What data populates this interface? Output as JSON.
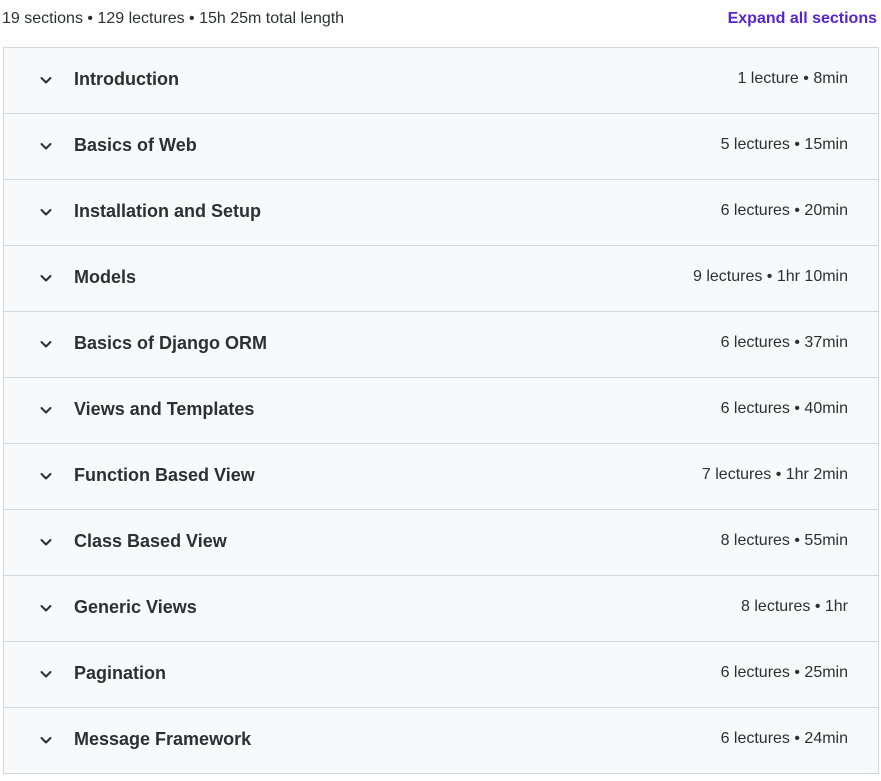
{
  "header": {
    "summary": "19 sections • 129 lectures • 15h 25m total length",
    "expand_all_label": "Expand all sections"
  },
  "colors": {
    "link": "#5624d0",
    "row_background": "#f7f9fa",
    "border": "#d1d7dc",
    "text": "#2d2f31"
  },
  "sections": [
    {
      "title": "Introduction",
      "meta": "1 lecture • 8min",
      "icon": "chevron-down-icon"
    },
    {
      "title": "Basics of Web",
      "meta": "5 lectures • 15min",
      "icon": "chevron-down-icon"
    },
    {
      "title": "Installation and Setup",
      "meta": "6 lectures • 20min",
      "icon": "chevron-down-icon"
    },
    {
      "title": "Models",
      "meta": "9 lectures • 1hr 10min",
      "icon": "chevron-down-icon"
    },
    {
      "title": "Basics of Django ORM",
      "meta": "6 lectures • 37min",
      "icon": "chevron-down-icon"
    },
    {
      "title": "Views and Templates",
      "meta": "6 lectures • 40min",
      "icon": "chevron-down-icon"
    },
    {
      "title": "Function Based View",
      "meta": "7 lectures • 1hr 2min",
      "icon": "chevron-down-icon"
    },
    {
      "title": "Class Based View",
      "meta": "8 lectures • 55min",
      "icon": "chevron-down-icon"
    },
    {
      "title": "Generic Views",
      "meta": "8 lectures • 1hr",
      "icon": "chevron-down-icon"
    },
    {
      "title": "Pagination",
      "meta": "6 lectures • 25min",
      "icon": "chevron-down-icon"
    },
    {
      "title": "Message Framework",
      "meta": "6 lectures • 24min",
      "icon": "chevron-down-icon"
    }
  ]
}
